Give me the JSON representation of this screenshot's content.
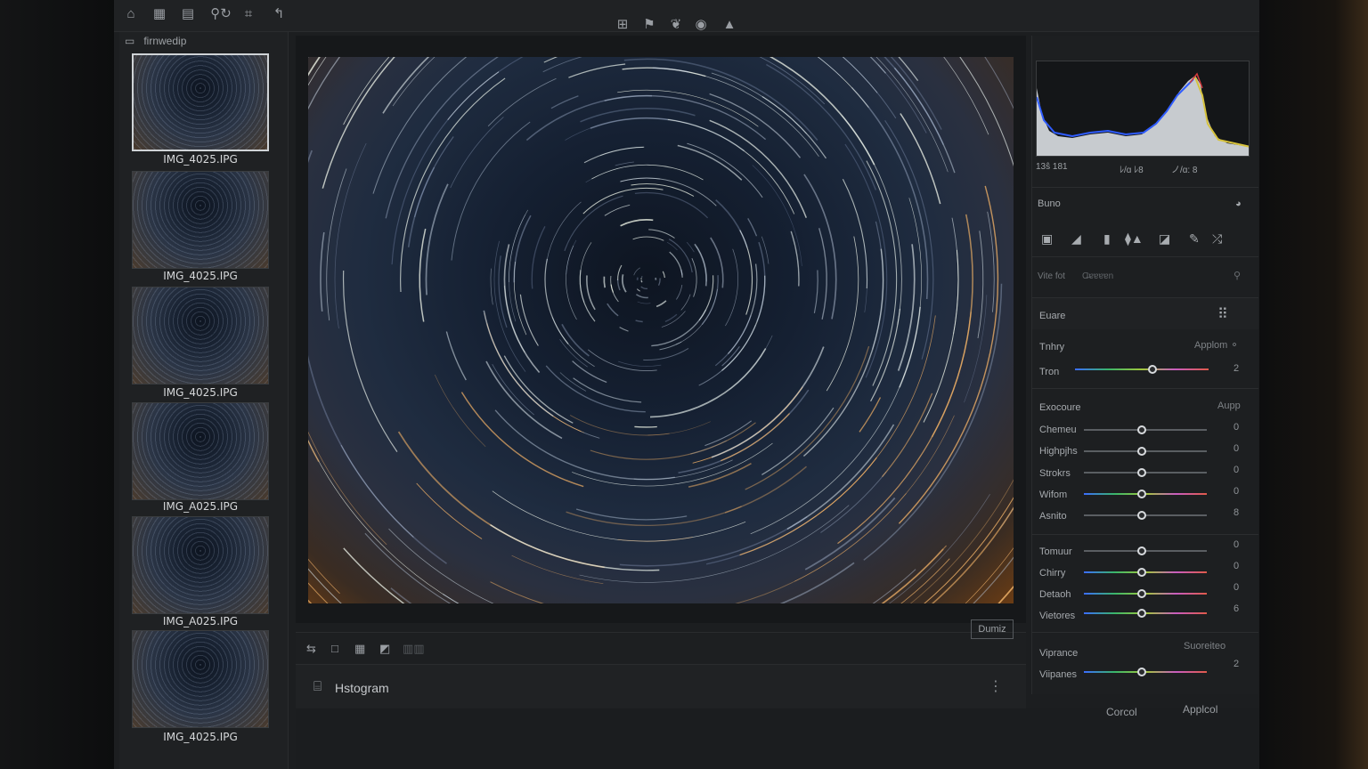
{
  "filmstrip": {
    "header": "firnwedip",
    "thumbnails": [
      {
        "label": "IMG_4025.IPG"
      },
      {
        "label": "IMG_4025.IPG"
      },
      {
        "label": "IMG_4025.IPG"
      },
      {
        "label": "IMG_A025.IPG"
      },
      {
        "label": "IMG_A025.IPG"
      },
      {
        "label": "IMG_4025.IPG"
      }
    ]
  },
  "histogram": {
    "readout_left": "13ŝ 181",
    "readout_mid": "ﾚ/ɑ ﾚ8",
    "readout_right": "ノ/ɑ: 8"
  },
  "panel": {
    "section1_title": "Buno",
    "vite_label": "Vite fot",
    "vite_value": "Ɑ̶ɐɐɐɐn",
    "basic_title": "Euare",
    "tinry_label": "Tnhry",
    "tinry_right": "Applom ⚬",
    "tron_label": "Tron",
    "tron_value": "2",
    "exposure_title": "Exocoure",
    "exposure_right": "Aupp",
    "sliders_a": [
      {
        "label": "Chemeu",
        "value": "0"
      },
      {
        "label": "Highpjhs",
        "value": "0"
      },
      {
        "label": "Strokrs",
        "value": "0"
      },
      {
        "label": "Wifom",
        "value": "0"
      },
      {
        "label": "Asnito",
        "value": "8"
      }
    ],
    "sliders_b": [
      {
        "label": "Tomuur",
        "value": "0"
      },
      {
        "label": "Chirry",
        "value": "0"
      },
      {
        "label": "Detaoh",
        "value": "0"
      },
      {
        "label": "Vietores",
        "value": "6"
      }
    ],
    "vibrance_label": "Viprance",
    "saturation_label": "Suoreiteo",
    "vibrance_slider_label": "Viipanes",
    "vibrance_value": "2"
  },
  "bottom": {
    "dumi_button": "Dumiz",
    "histogram_label": "Hstogram",
    "cancel_button": "Corcol",
    "apply_button": "Applcol"
  },
  "colors": {
    "accent": "#d7dadd",
    "panel_bg": "#1d1f21"
  }
}
